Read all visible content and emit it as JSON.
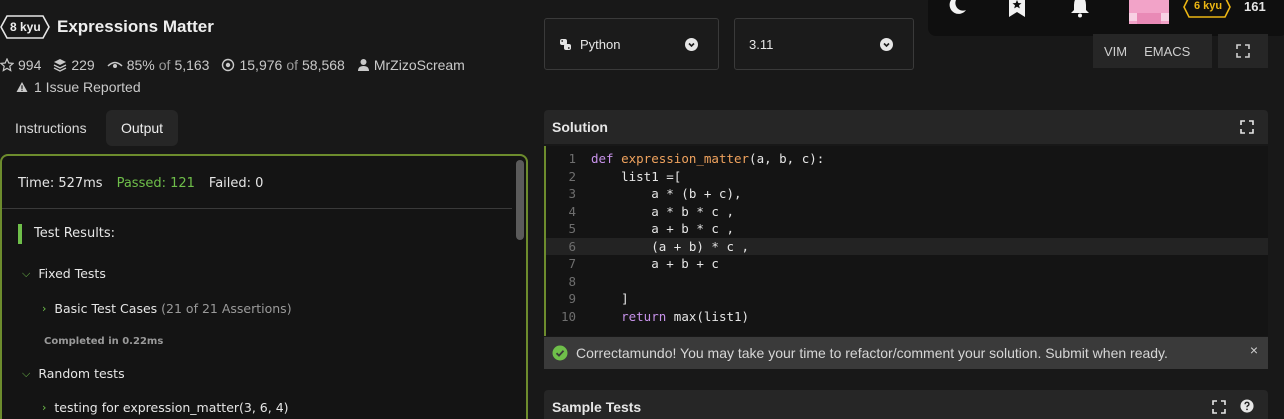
{
  "kata": {
    "rank": "8 kyu",
    "title": "Expressions Matter",
    "stars": "994",
    "collections": "229",
    "satisfaction_pct": "85%",
    "satisfaction_of": "of",
    "satisfaction_votes": "5,163",
    "completed": "15,976",
    "completed_of": "of",
    "attempts": "58,568",
    "author": "MrZizoScream",
    "issues": "1 Issue Reported"
  },
  "tabs": {
    "instructions": "Instructions",
    "output": "Output"
  },
  "output": {
    "time": "Time: 527ms",
    "passed": "Passed: 121",
    "failed": "Failed: 0",
    "results_heading": "Test Results:",
    "fixed_tests": "Fixed Tests",
    "basic_test_cases": "Basic Test Cases",
    "basic_assertions": "(21 of 21 Assertions)",
    "completed_in": "Completed in 0.22ms",
    "random_tests": "Random tests",
    "random_item": "testing for expression_matter(3, 6, 4)"
  },
  "selectors": {
    "language": "Python",
    "version": "3.11"
  },
  "editor_modes": {
    "vim": "VIM",
    "emacs": "EMACS"
  },
  "user": {
    "rank": "6 kyu",
    "honor": "161"
  },
  "solution": {
    "title": "Solution",
    "lines": [
      {
        "n": "1",
        "code": "def expression_matter(a, b, c):"
      },
      {
        "n": "2",
        "code": "    list1 =["
      },
      {
        "n": "3",
        "code": "        a * (b + c),"
      },
      {
        "n": "4",
        "code": "        a * b * c ,"
      },
      {
        "n": "5",
        "code": "        a + b * c ,"
      },
      {
        "n": "6",
        "code": "        (a + b) * c ,"
      },
      {
        "n": "7",
        "code": "        a + b + c"
      },
      {
        "n": "8",
        "code": ""
      },
      {
        "n": "9",
        "code": "    ]"
      },
      {
        "n": "10",
        "code": "    return max(list1)"
      }
    ]
  },
  "notice": {
    "text": "Correctamundo! You may take your time to refactor/comment your solution. Submit when ready.",
    "close": "×"
  },
  "sample_tests": {
    "title": "Sample Tests"
  },
  "colors": {
    "accent_green": "#6fbf4a",
    "panel_border": "#6d8c2d",
    "rank_yellow": "#ecb613",
    "avatar_pink": "#f2a3c8"
  }
}
